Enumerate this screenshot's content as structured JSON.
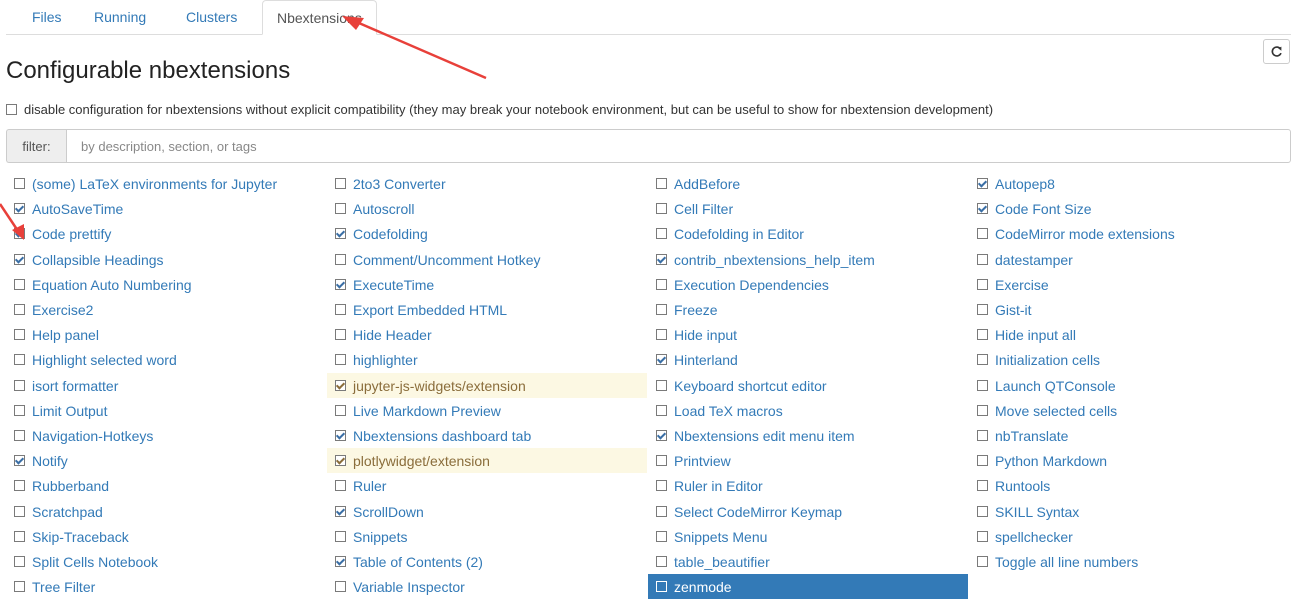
{
  "tabs": [
    {
      "label": "Files",
      "active": false
    },
    {
      "label": "Running",
      "active": false
    },
    {
      "label": "Clusters",
      "active": false
    },
    {
      "label": "Nbextensions",
      "active": true
    }
  ],
  "page_title": "Configurable nbextensions",
  "compat": {
    "checked": false,
    "label": "disable configuration for nbextensions without explicit compatibility (they may break your notebook environment, but can be useful to show for nbextension development)"
  },
  "filter": {
    "label": "filter:",
    "placeholder": "by description, section, or tags",
    "value": ""
  },
  "colors": {
    "link": "#337ab7",
    "warn_bg": "#fcf8e3",
    "selected_bg": "#337ab7",
    "annotation_arrow": "#e8403a"
  },
  "extension_columns": [
    [
      {
        "label": "(some) LaTeX environments for Jupyter",
        "checked": false
      },
      {
        "label": "AutoSaveTime",
        "checked": true
      },
      {
        "label": "Code prettify",
        "checked": true
      },
      {
        "label": "Collapsible Headings",
        "checked": true
      },
      {
        "label": "Equation Auto Numbering",
        "checked": false
      },
      {
        "label": "Exercise2",
        "checked": false
      },
      {
        "label": "Help panel",
        "checked": false
      },
      {
        "label": "Highlight selected word",
        "checked": false
      },
      {
        "label": "isort formatter",
        "checked": false
      },
      {
        "label": "Limit Output",
        "checked": false
      },
      {
        "label": "Navigation-Hotkeys",
        "checked": false
      },
      {
        "label": "Notify",
        "checked": true
      },
      {
        "label": "Rubberband",
        "checked": false
      },
      {
        "label": "Scratchpad",
        "checked": false
      },
      {
        "label": "Skip-Traceback",
        "checked": false
      },
      {
        "label": "Split Cells Notebook",
        "checked": false
      },
      {
        "label": "Tree Filter",
        "checked": false
      }
    ],
    [
      {
        "label": "2to3 Converter",
        "checked": false
      },
      {
        "label": "Autoscroll",
        "checked": false
      },
      {
        "label": "Codefolding",
        "checked": true
      },
      {
        "label": "Comment/Uncomment Hotkey",
        "checked": false
      },
      {
        "label": "ExecuteTime",
        "checked": true
      },
      {
        "label": "Export Embedded HTML",
        "checked": false
      },
      {
        "label": "Hide Header",
        "checked": false
      },
      {
        "label": "highlighter",
        "checked": false
      },
      {
        "label": "jupyter-js-widgets/extension",
        "checked": true,
        "state": "warn"
      },
      {
        "label": "Live Markdown Preview",
        "checked": false
      },
      {
        "label": "Nbextensions dashboard tab",
        "checked": true
      },
      {
        "label": "plotlywidget/extension",
        "checked": true,
        "state": "warn"
      },
      {
        "label": "Ruler",
        "checked": false
      },
      {
        "label": "ScrollDown",
        "checked": true
      },
      {
        "label": "Snippets",
        "checked": false
      },
      {
        "label": "Table of Contents (2)",
        "checked": true
      },
      {
        "label": "Variable Inspector",
        "checked": false
      }
    ],
    [
      {
        "label": "AddBefore",
        "checked": false
      },
      {
        "label": "Cell Filter",
        "checked": false
      },
      {
        "label": "Codefolding in Editor",
        "checked": false
      },
      {
        "label": "contrib_nbextensions_help_item",
        "checked": true
      },
      {
        "label": "Execution Dependencies",
        "checked": false
      },
      {
        "label": "Freeze",
        "checked": false
      },
      {
        "label": "Hide input",
        "checked": false
      },
      {
        "label": "Hinterland",
        "checked": true
      },
      {
        "label": "Keyboard shortcut editor",
        "checked": false
      },
      {
        "label": "Load TeX macros",
        "checked": false
      },
      {
        "label": "Nbextensions edit menu item",
        "checked": true
      },
      {
        "label": "Printview",
        "checked": false
      },
      {
        "label": "Ruler in Editor",
        "checked": false
      },
      {
        "label": "Select CodeMirror Keymap",
        "checked": false
      },
      {
        "label": "Snippets Menu",
        "checked": false
      },
      {
        "label": "table_beautifier",
        "checked": false
      },
      {
        "label": "zenmode",
        "checked": false,
        "state": "selected"
      }
    ],
    [
      {
        "label": "Autopep8",
        "checked": true
      },
      {
        "label": "Code Font Size",
        "checked": true
      },
      {
        "label": "CodeMirror mode extensions",
        "checked": false
      },
      {
        "label": "datestamper",
        "checked": false
      },
      {
        "label": "Exercise",
        "checked": false
      },
      {
        "label": "Gist-it",
        "checked": false
      },
      {
        "label": "Hide input all",
        "checked": false
      },
      {
        "label": "Initialization cells",
        "checked": false
      },
      {
        "label": "Launch QTConsole",
        "checked": false
      },
      {
        "label": "Move selected cells",
        "checked": false
      },
      {
        "label": "nbTranslate",
        "checked": false
      },
      {
        "label": "Python Markdown",
        "checked": false
      },
      {
        "label": "Runtools",
        "checked": false
      },
      {
        "label": "SKILL Syntax",
        "checked": false
      },
      {
        "label": "spellchecker",
        "checked": false
      },
      {
        "label": "Toggle all line numbers",
        "checked": false
      }
    ]
  ]
}
